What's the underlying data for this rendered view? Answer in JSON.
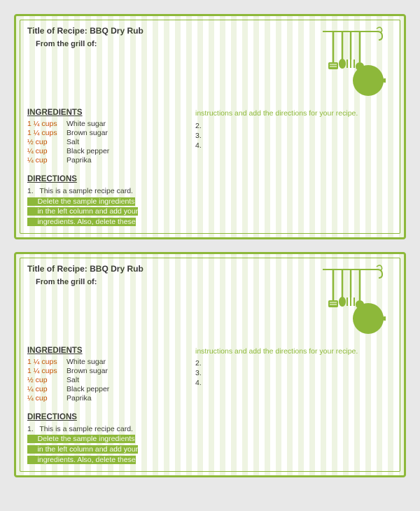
{
  "cards": [
    {
      "id": "card-1",
      "title": "Title of Recipe: BBQ Dry Rub",
      "from": "From the grill of:",
      "ingredients_label": "INGREDIENTS",
      "ingredients": [
        {
          "amount": "1 ¼ cups",
          "name": "White sugar"
        },
        {
          "amount": "1 ¼ cups",
          "name": "Brown sugar"
        },
        {
          "amount": "½ cup",
          "name": "Salt"
        },
        {
          "amount": "¼ cup",
          "name": "Black pepper"
        },
        {
          "amount": "¼ cup",
          "name": "Paprika"
        }
      ],
      "instructions_prompt": "instructions and add the directions for your recipe.",
      "instruction_numbers": [
        "2.",
        "3.",
        "4."
      ],
      "directions_label": "DIRECTIONS",
      "directions": "1.   This is a sample recipe card. Delete the sample ingredients in the left column and add your ingredients. Also, delete these"
    },
    {
      "id": "card-2",
      "title": "Title of Recipe: BBQ Dry Rub",
      "from": "From the grill of:",
      "ingredients_label": "INGREDIENTS",
      "ingredients": [
        {
          "amount": "1 ¼ cups",
          "name": "White sugar"
        },
        {
          "amount": "1 ¼ cups",
          "name": "Brown sugar"
        },
        {
          "amount": "½ cup",
          "name": "Salt"
        },
        {
          "amount": "¼ cup",
          "name": "Black pepper"
        },
        {
          "amount": "¼ cup",
          "name": "Paprika"
        }
      ],
      "instructions_prompt": "instructions and add the directions for your recipe.",
      "instruction_numbers": [
        "2.",
        "3.",
        "4."
      ],
      "directions_label": "DIRECTIONS",
      "directions": "1.   This is a sample recipe card. Delete the sample ingredients in the left column and add your ingredients. Also, delete these"
    }
  ],
  "colors": {
    "green": "#8db83a",
    "orange": "#c94a00",
    "dark": "#333333"
  }
}
